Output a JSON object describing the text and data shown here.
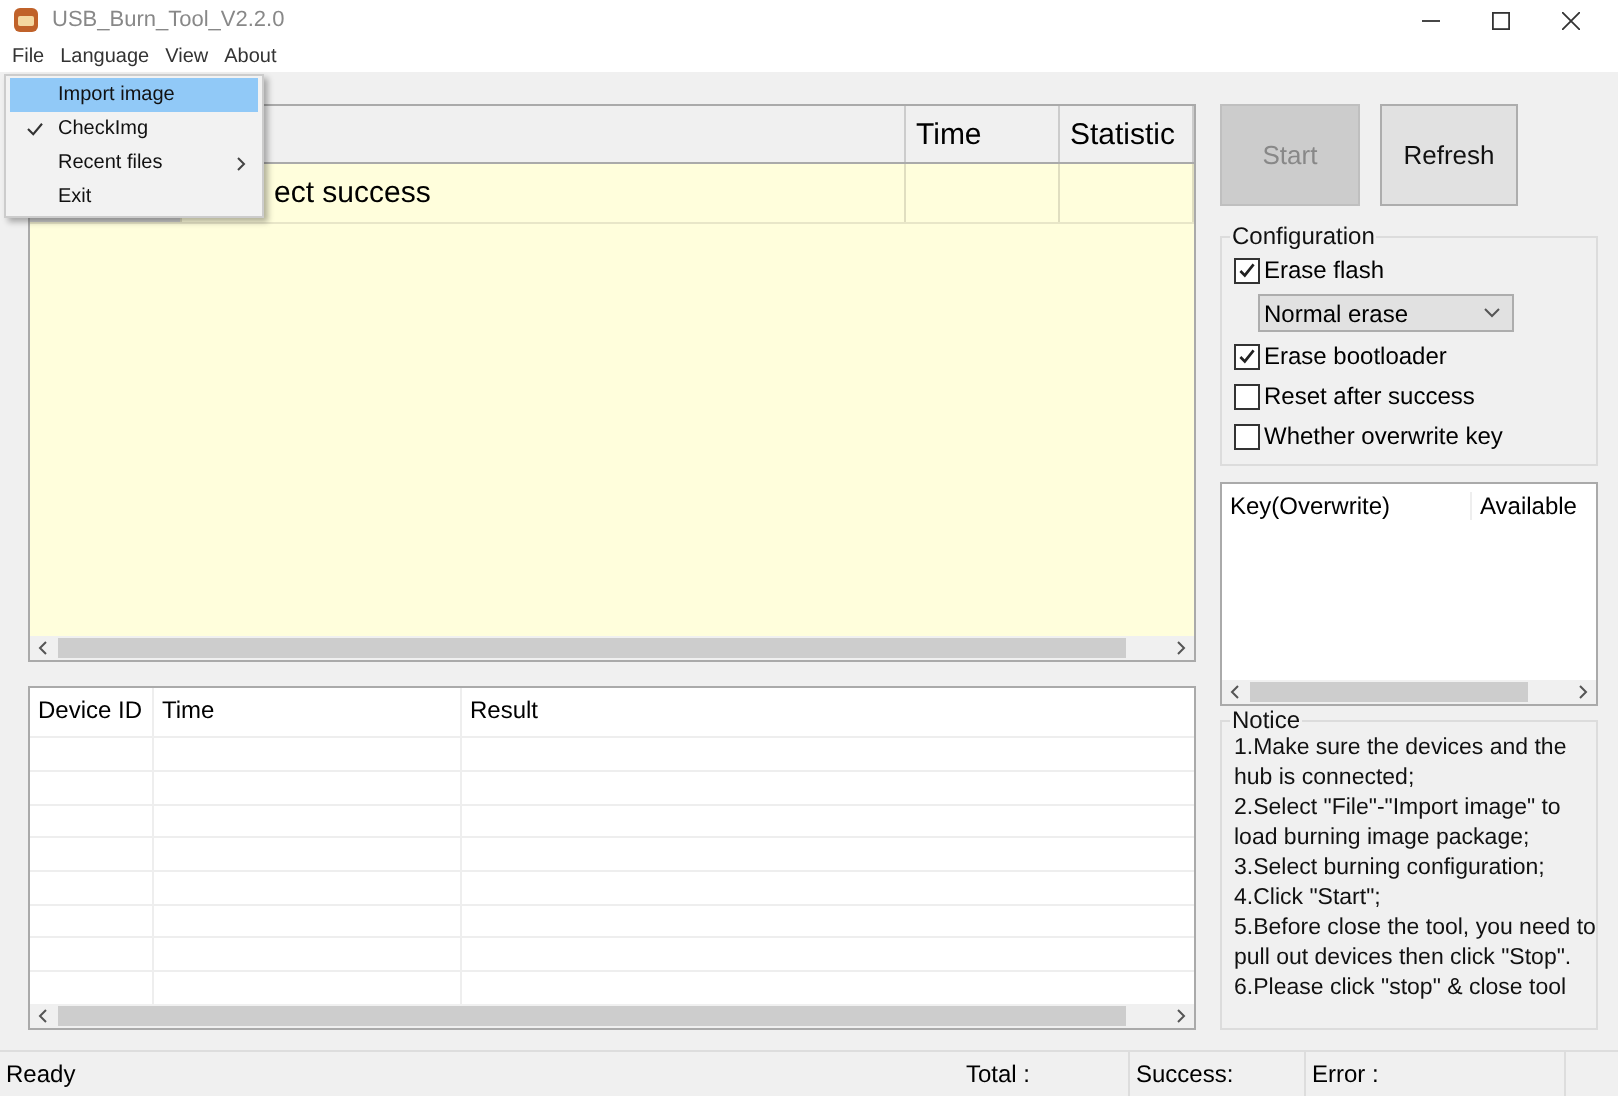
{
  "window": {
    "title": "USB_Burn_Tool_V2.2.0"
  },
  "menu_bar": [
    "File",
    "Language",
    "View",
    "About"
  ],
  "file_menu": [
    {
      "label": "Import image",
      "selected": true,
      "checked": false,
      "submenu": false
    },
    {
      "label": "CheckImg",
      "selected": false,
      "checked": true,
      "submenu": false
    },
    {
      "label": "Recent files",
      "selected": false,
      "checked": false,
      "submenu": true
    },
    {
      "label": "Exit",
      "selected": false,
      "checked": false,
      "submenu": false
    }
  ],
  "device_table": {
    "columns": [
      "",
      "",
      "Time",
      "Statistic"
    ],
    "rows": [
      [
        "",
        "ect success",
        "",
        ""
      ]
    ]
  },
  "result_table": {
    "columns": [
      "Device ID",
      "Time",
      "Result"
    ]
  },
  "buttons": [
    {
      "label": "Start",
      "disabled": true
    },
    {
      "label": "Refresh",
      "disabled": false
    }
  ],
  "configuration": {
    "title": "Configuration",
    "options": [
      {
        "kind": "checkbox",
        "label": "Erase flash",
        "checked": true
      },
      {
        "kind": "select",
        "value": "Normal erase"
      },
      {
        "kind": "checkbox",
        "label": "Erase bootloader",
        "checked": true
      },
      {
        "kind": "checkbox",
        "label": "Reset after success",
        "checked": false
      },
      {
        "kind": "checkbox",
        "label": "Whether overwrite key",
        "checked": false
      }
    ]
  },
  "key_table": {
    "columns": [
      "Key(Overwrite)",
      "Available"
    ]
  },
  "notice": {
    "title": "Notice",
    "lines": [
      "1.Make sure the devices and the hub is connected;",
      "2.Select \"File\"-\"Import image\" to load burning image package;",
      "3.Select burning configuration;",
      "4.Click \"Start\";",
      "5.Before close the tool, you need to pull out devices then click \"Stop\".",
      "6.Please click \"stop\" & close tool"
    ]
  },
  "status_bar": [
    "Ready",
    "Total :",
    "Success:",
    "Error :"
  ]
}
